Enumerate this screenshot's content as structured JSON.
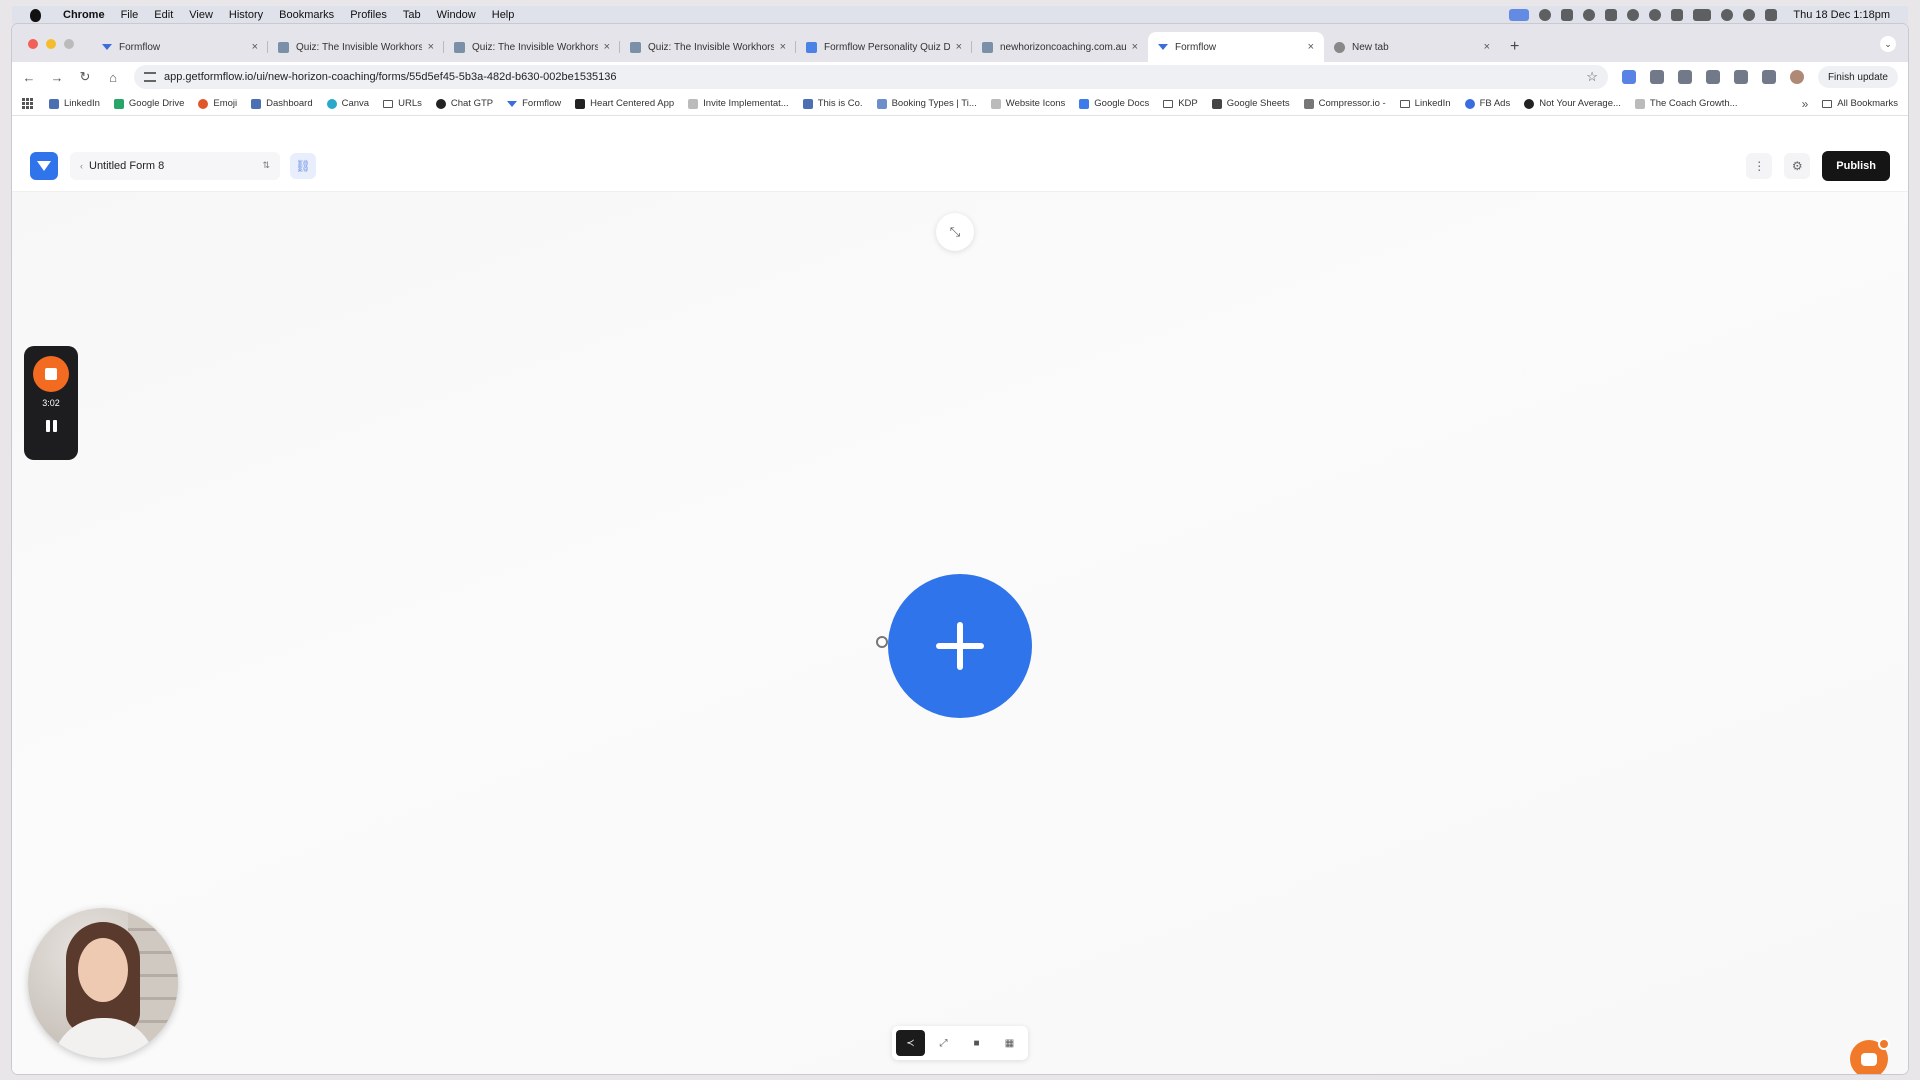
{
  "menubar": {
    "items": [
      "Chrome",
      "File",
      "Edit",
      "View",
      "History",
      "Bookmarks",
      "Profiles",
      "Tab",
      "Window",
      "Help"
    ],
    "clock": "Thu 18 Dec 1:18pm"
  },
  "tabs": [
    {
      "label": "Formflow",
      "icon": "formflow-icon"
    },
    {
      "label": "Quiz: The Invisible Workhors",
      "icon": "page-icon"
    },
    {
      "label": "Quiz: The Invisible Workhors",
      "icon": "page-icon"
    },
    {
      "label": "Quiz: The Invisible Workhors",
      "icon": "page-icon"
    },
    {
      "label": "Formflow Personality Quiz De",
      "icon": "doc-icon"
    },
    {
      "label": "newhorizoncoaching.com.au",
      "icon": "page-icon"
    },
    {
      "label": "Formflow",
      "icon": "formflow-icon",
      "active": true
    },
    {
      "label": "New tab",
      "icon": "chrome-icon"
    }
  ],
  "toolbar": {
    "url": "app.getformflow.io/ui/new-horizon-coaching/forms/55d5ef45-5b3a-482d-b630-002be1535136",
    "finish_update": "Finish update"
  },
  "bookmarks": [
    {
      "label": "LinkedIn",
      "icon": "linkedin-icon"
    },
    {
      "label": "Google Drive",
      "icon": "drive-icon"
    },
    {
      "label": "Emoji",
      "icon": "emoji-icon"
    },
    {
      "label": "Dashboard",
      "icon": "dashboard-icon"
    },
    {
      "label": "Canva",
      "icon": "canva-icon"
    },
    {
      "label": "URLs",
      "icon": "folder-icon"
    },
    {
      "label": "Chat GTP",
      "icon": "chatgpt-icon"
    },
    {
      "label": "Formflow",
      "icon": "formflow-icon"
    },
    {
      "label": "Heart Centered App",
      "icon": "app-icon"
    },
    {
      "label": "Invite Implementat...",
      "icon": "link-icon"
    },
    {
      "label": "This is Co.",
      "icon": "page-icon"
    },
    {
      "label": "Booking Types | Ti...",
      "icon": "calendar-icon"
    },
    {
      "label": "Website Icons",
      "icon": "link-icon"
    },
    {
      "label": "Google Docs",
      "icon": "docs-icon"
    },
    {
      "label": "KDP",
      "icon": "folder-icon"
    },
    {
      "label": "Google Sheets",
      "icon": "sheets-icon"
    },
    {
      "label": "Compressor.io -",
      "icon": "compressor-icon"
    },
    {
      "label": "LinkedIn",
      "icon": "folder-icon"
    },
    {
      "label": "FB Ads",
      "icon": "meta-icon"
    },
    {
      "label": "Not Your Average...",
      "icon": "page-icon"
    },
    {
      "label": "The Coach Growth...",
      "icon": "link-icon"
    }
  ],
  "all_bookmarks": "All Bookmarks",
  "app": {
    "form_name": "Untitled Form 8",
    "publish": "Publish"
  },
  "recorder": {
    "time": "3:02"
  },
  "colors": {
    "brand_blue": "#2f74ea",
    "publish_bg": "#151515",
    "record_orange": "#f26b21"
  }
}
